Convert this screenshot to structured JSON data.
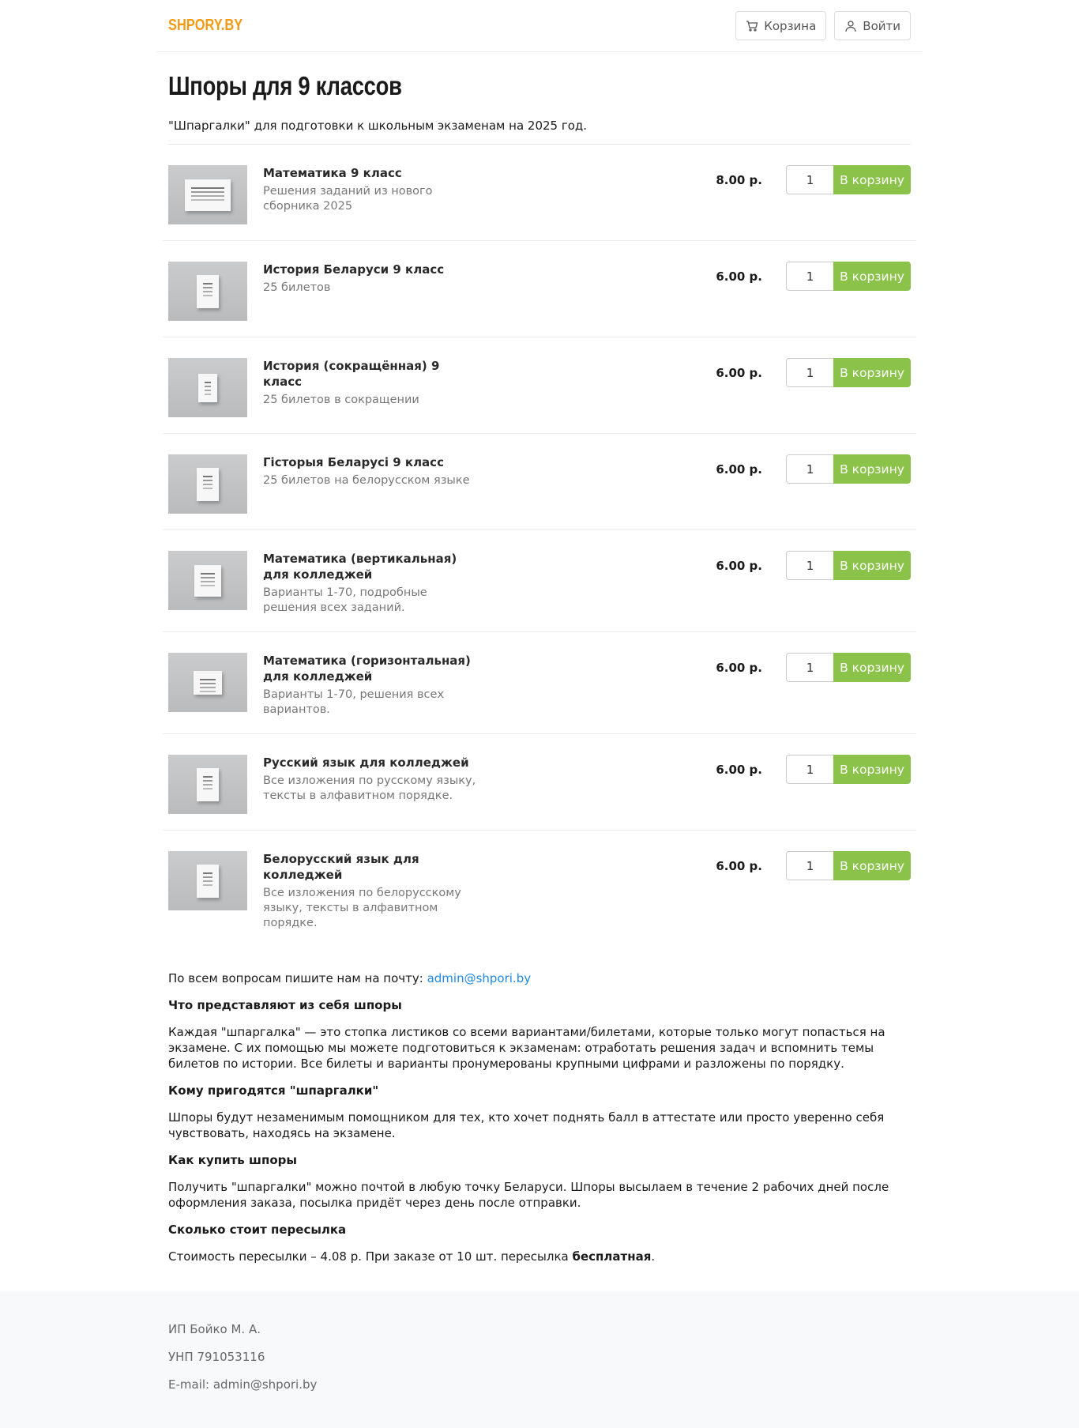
{
  "header": {
    "logo": "SHPORY.BY",
    "cart_label": "Корзина",
    "login_label": "Войти"
  },
  "page": {
    "title": "Шпоры для 9 классов",
    "lead": "\"Шпаргалки\" для подготовки к школьным экзаменам на 2025 год."
  },
  "cart_button_label": "В корзину",
  "products": [
    {
      "name": "Математика 9 класс",
      "desc": "Решения заданий из нового сборника 2025",
      "price": "8.00 р.",
      "qty": "1",
      "cover": "open"
    },
    {
      "name": "История Беларуси 9 класс",
      "desc": "25 билетов",
      "price": "6.00 р.",
      "qty": "1",
      "cover": "vertical"
    },
    {
      "name": "История (сокращённая) 9 класс",
      "desc": "25 билетов в сокращении",
      "price": "6.00 р.",
      "qty": "1",
      "cover": "vertical-small"
    },
    {
      "name": "Гісторыя Беларусі 9 класс",
      "desc": "25 билетов на белорусском языке",
      "price": "6.00 р.",
      "qty": "1",
      "cover": "vertical"
    },
    {
      "name": "Математика (вертикальная) для колледжей",
      "desc": "Варианты 1-70, подробные решения всех заданий.",
      "price": "6.00 р.",
      "qty": "1",
      "cover": "box"
    },
    {
      "name": "Математика (горизонтальная) для колледжей",
      "desc": "Варианты 1-70, решения всех вариантов.",
      "price": "6.00 р.",
      "qty": "1",
      "cover": "box-horizontal"
    },
    {
      "name": "Русский язык для колледжей",
      "desc": "Все изложения по русскому языку, тексты в алфавитном порядке.",
      "price": "6.00 р.",
      "qty": "1",
      "cover": "vertical"
    },
    {
      "name": "Белорусский язык для колледжей",
      "desc": "Все изложения по белорусскому языку, тексты в алфавитном порядке.",
      "price": "6.00 р.",
      "qty": "1",
      "cover": "vertical"
    }
  ],
  "about": {
    "contact_text": "По всем вопросам пишите нам на почту: ",
    "contact_email": "admin@shpori.by",
    "q1": "Что представляют из себя шпоры",
    "a1": "Каждая \"шпаргалка\" — это стопка листиков со всеми вариантами/билетами, которые только могут попасться на экзамене. С их помощью мы можете подготовиться к экзаменам: отработать решения задач и вспомнить темы билетов по истории. Все билеты и варианты пронумерованы крупными цифрами и разложены по порядку.",
    "q2": "Кому пригодятся \"шпаргалки\"",
    "a2": "Шпоры будут незаменимым помощником для тех, кто хочет поднять балл в аттестате или просто уверенно себя чувствовать, находясь на экзамене.",
    "q3": "Как купить шпоры",
    "a3": "Получить \"шпаргалки\" можно почтой в любую точку Беларуси. Шпоры высылаем в течение 2 рабочих дней после оформления заказа, посылка придёт через день после отправки.",
    "q4": "Сколько стоит пересылка",
    "a4_prefix": "Стоимость пересылки – 4.08 р. При заказе от 10 шт. пересылка ",
    "a4_bold": "бесплатная",
    "a4_suffix": "."
  },
  "footer": {
    "company": "ИП Бойко М. А.",
    "unp": "УНП 791053116",
    "email": "E-mail: admin@shpori.by"
  },
  "colors": {
    "logo": "#f29a13",
    "accent_button": "#8bc34a",
    "link": "#1e88e5"
  }
}
